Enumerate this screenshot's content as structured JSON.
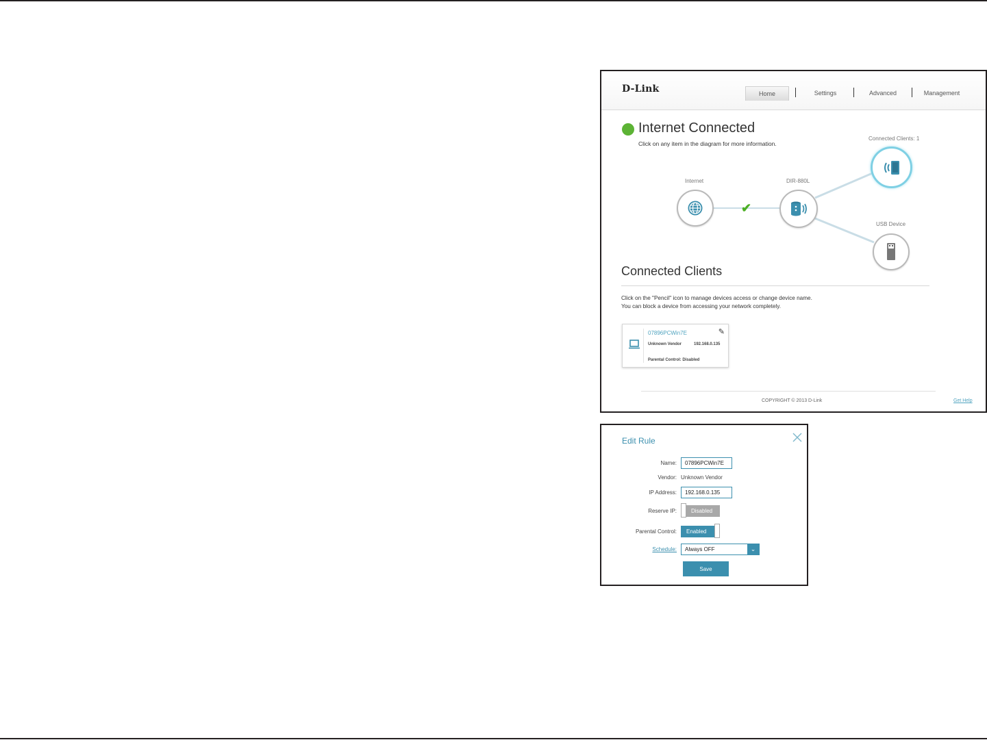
{
  "home": {
    "logo": "D-Link",
    "nav": [
      {
        "label": "Home",
        "active": true
      },
      {
        "label": "Settings",
        "active": false
      },
      {
        "label": "Advanced",
        "active": false
      },
      {
        "label": "Management",
        "active": false
      }
    ],
    "status": {
      "title": "Internet Connected",
      "subtitle": "Click on any item in the diagram for more information.",
      "color": "#5cb335"
    },
    "diagram": {
      "internet_label": "Internet",
      "router_label": "DIR-880L",
      "clients_label": "Connected Clients: 1",
      "usb_label": "USB Device"
    },
    "clients_section": {
      "title": "Connected Clients",
      "hint1": "Click on the \"Pencil\" icon to manage devices access or change device name.",
      "hint2": "You can block a device from accessing your network completely."
    },
    "client": {
      "name": "07896PCWin7E",
      "vendor": "Unknown Vendor",
      "ip": "192.168.0.135",
      "parental": "Parental Control: Disabled"
    },
    "footer": {
      "copyright": "COPYRIGHT © 2013 D-Link",
      "help": "Get Help"
    }
  },
  "edit_rule": {
    "title": "Edit Rule",
    "name_label": "Name:",
    "name_value": "07896PCWin7E",
    "vendor_label": "Vendor:",
    "vendor_value": "Unknown Vendor",
    "ip_label": "IP Address:",
    "ip_value": "192.168.0.135",
    "reserve_label": "Reserve IP:",
    "reserve_state": "Disabled",
    "parental_label": "Parental Control:",
    "parental_state": "Enabled",
    "schedule_label": "Schedule:",
    "schedule_value": "Always OFF",
    "save_label": "Save",
    "accent": "#3b8fae"
  }
}
